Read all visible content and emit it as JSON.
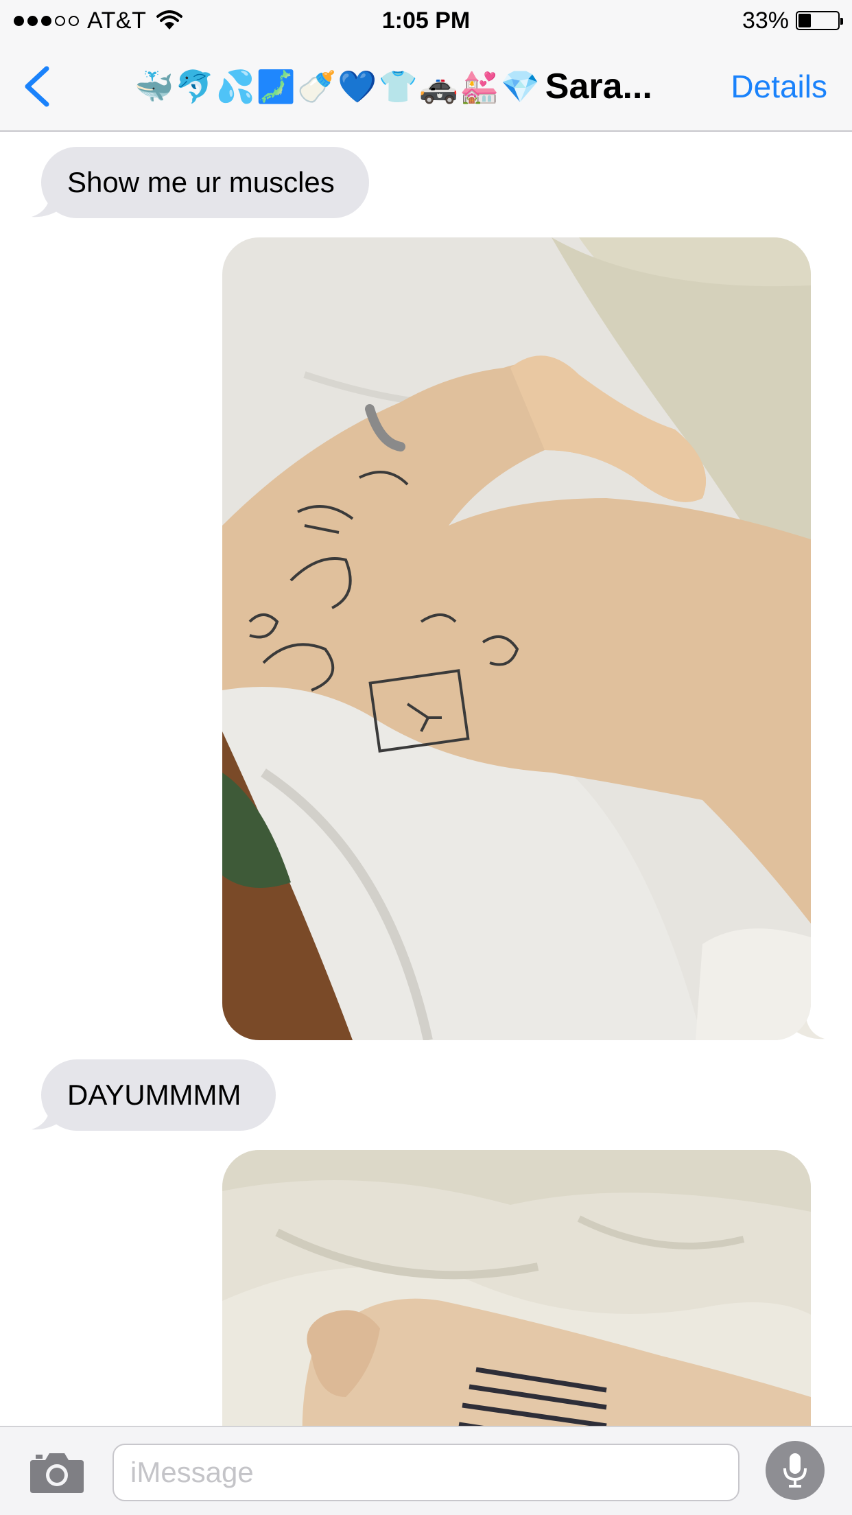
{
  "status_bar": {
    "carrier": "AT&T",
    "time": "1:05 PM",
    "battery_percent": "33%",
    "battery_level": 0.33,
    "signal_bars": 3,
    "signal_total": 5
  },
  "nav": {
    "emoji": "🐳🐬💦🗾🍼💙👕🚓💒💎",
    "name": "Sara...",
    "details_label": "Details"
  },
  "messages": [
    {
      "direction": "incoming",
      "type": "text",
      "text": "Show me ur muscles"
    },
    {
      "direction": "outgoing",
      "type": "photo",
      "subject": "tattooed-arm-flexing"
    },
    {
      "direction": "incoming",
      "type": "text",
      "text": "DAYUMMMM"
    },
    {
      "direction": "outgoing",
      "type": "photo",
      "subject": "tattooed-forearm-on-sheets"
    }
  ],
  "input": {
    "placeholder": "iMessage"
  },
  "colors": {
    "accent": "#1a82fb",
    "incoming_bubble": "#e5e5ea",
    "bar_background": "#f7f7f8"
  }
}
